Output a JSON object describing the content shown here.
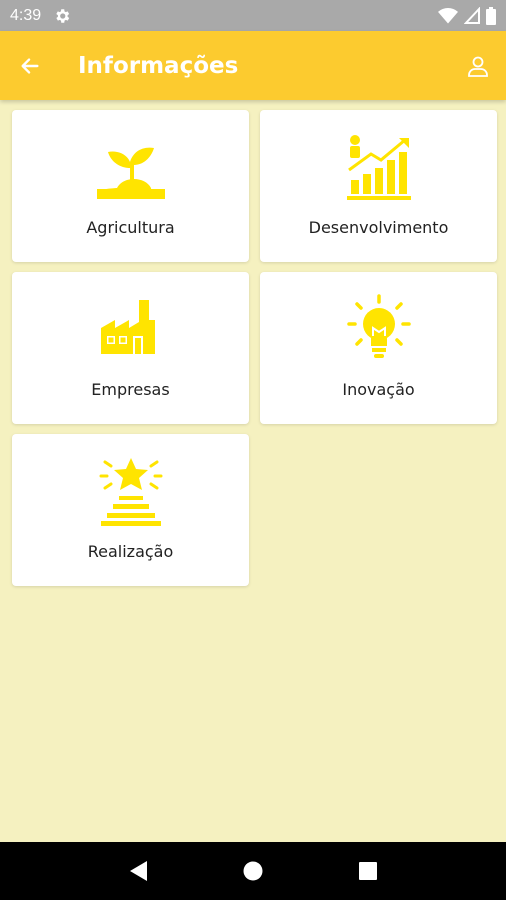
{
  "status_bar": {
    "time": "4:39",
    "icons": [
      "settings-icon",
      "wifi-icon",
      "signal-icon",
      "battery-icon"
    ]
  },
  "app_bar": {
    "title": "Informações",
    "back_icon": "arrow-left-icon",
    "profile_icon": "person-icon"
  },
  "colors": {
    "accent": "#fccb2f",
    "icon_yellow": "#ffe400",
    "background": "#f5f1c0"
  },
  "categories": [
    {
      "label": "Agricultura",
      "icon": "sprout-icon"
    },
    {
      "label": "Desenvolvimento",
      "icon": "growth-chart-icon"
    },
    {
      "label": "Empresas",
      "icon": "factory-icon"
    },
    {
      "label": "Inovação",
      "icon": "lightbulb-icon"
    },
    {
      "label": "Realização",
      "icon": "star-podium-icon"
    }
  ],
  "nav_bar": {
    "items": [
      "back-triangle-icon",
      "home-circle-icon",
      "recents-square-icon"
    ]
  }
}
